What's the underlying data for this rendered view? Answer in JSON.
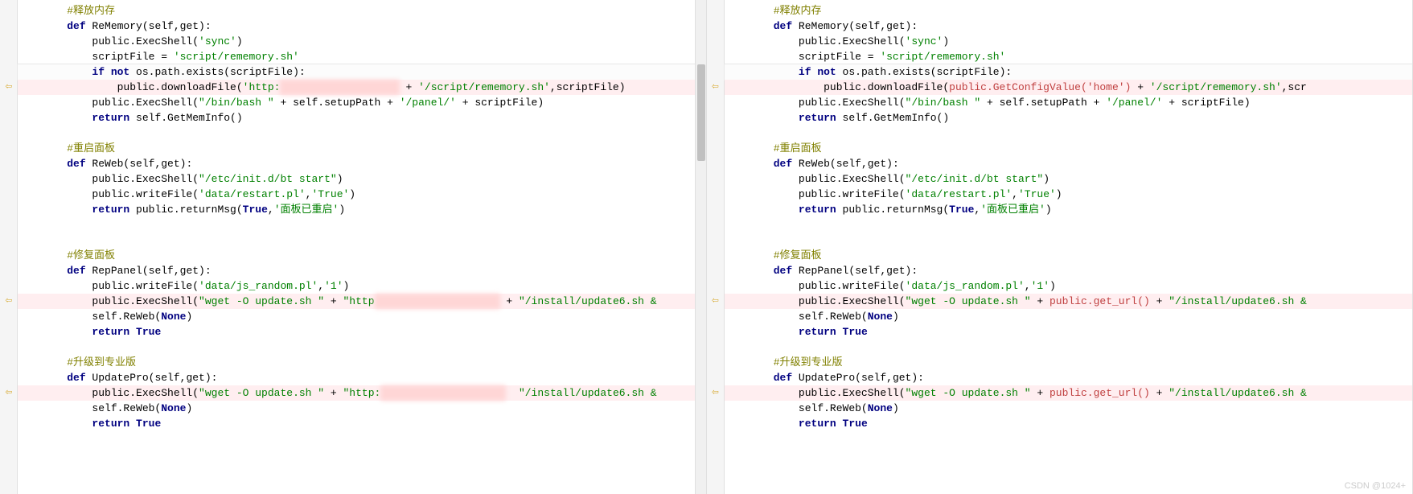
{
  "left": {
    "lines": [
      {
        "indent": 1,
        "type": "comment",
        "text": "#释放内存"
      },
      {
        "indent": 1,
        "type": "def",
        "kw": "def",
        "name": "ReMemory",
        "params": "(self,get):"
      },
      {
        "indent": 2,
        "type": "call",
        "prefix": "public.ExecShell(",
        "str": "'sync'",
        "suffix": ")"
      },
      {
        "indent": 2,
        "type": "assign",
        "prefix": "scriptFile = ",
        "str": "'script/rememory.sh'"
      },
      {
        "indent": 2,
        "type": "if",
        "kw": "if not",
        "rest": " os.path.exists(scriptFile):",
        "current": true
      },
      {
        "indent": 3,
        "type": "diff-call",
        "prefix": "public.downloadFile(",
        "str1": "'http:",
        "redacted": "xxxxxxxxxxxxxxxxxxx",
        "mid": " + ",
        "str2": "'/script/rememory.sh'",
        "suffix": ",scriptFile)",
        "diff": true,
        "arrow": true
      },
      {
        "indent": 2,
        "type": "call2",
        "prefix": "public.ExecShell(",
        "str1": "\"/bin/bash \"",
        "mid1": " + self.setupPath + ",
        "str2": "'/panel/'",
        "suffix": " + scriptFile)"
      },
      {
        "indent": 2,
        "type": "return",
        "kw": "return",
        "rest": " self.GetMemInfo()"
      },
      {
        "indent": 0,
        "type": "blank"
      },
      {
        "indent": 1,
        "type": "comment",
        "text": "#重启面板"
      },
      {
        "indent": 1,
        "type": "def",
        "kw": "def",
        "name": "ReWeb",
        "params": "(self,get):"
      },
      {
        "indent": 2,
        "type": "call",
        "prefix": "public.ExecShell(",
        "str": "\"/etc/init.d/bt start\"",
        "suffix": ")"
      },
      {
        "indent": 2,
        "type": "call3",
        "prefix": "public.writeFile(",
        "str1": "'data/restart.pl'",
        "mid": ",",
        "str2": "'True'",
        "suffix": ")"
      },
      {
        "indent": 2,
        "type": "return2",
        "kw": "return",
        "prefix": " public.returnMsg(",
        "bool": "True",
        "mid": ",",
        "str": "'面板已重启'",
        "suffix": ")"
      },
      {
        "indent": 0,
        "type": "blank"
      },
      {
        "indent": 0,
        "type": "blank"
      },
      {
        "indent": 1,
        "type": "comment",
        "text": "#修复面板"
      },
      {
        "indent": 1,
        "type": "def",
        "kw": "def",
        "name": "RepPanel",
        "params": "(self,get):"
      },
      {
        "indent": 2,
        "type": "call3",
        "prefix": "public.writeFile(",
        "str1": "'data/js_random.pl'",
        "mid": ",",
        "str2": "'1'",
        "suffix": ")"
      },
      {
        "indent": 2,
        "type": "diff-call2",
        "prefix": "public.ExecShell(",
        "str1": "\"wget -O update.sh \"",
        "mid1": " + ",
        "str2": "\"http",
        "redacted": "xxxxxxxxxxxxxxxxxxxx",
        "mid2": " + ",
        "str3": "\"/install/update6.sh &",
        "diff": true,
        "arrow": true
      },
      {
        "indent": 2,
        "type": "call4",
        "prefix": "self.ReWeb(",
        "bool": "None",
        "suffix": ")"
      },
      {
        "indent": 2,
        "type": "return3",
        "kw": "return",
        "bool": "True"
      },
      {
        "indent": 0,
        "type": "blank"
      },
      {
        "indent": 1,
        "type": "comment",
        "text": "#升级到专业版"
      },
      {
        "indent": 1,
        "type": "def",
        "kw": "def",
        "name": "UpdatePro",
        "params": "(self,get):"
      },
      {
        "indent": 2,
        "type": "diff-call2",
        "prefix": "public.ExecShell(",
        "str1": "\"wget -O update.sh \"",
        "mid1": " + ",
        "str2": "\"http:",
        "redacted": "xxxxxxxxxxxxxxxxxxxx",
        "mid2": "  ",
        "str3": "\"/install/update6.sh &",
        "diff": true,
        "arrow": true
      },
      {
        "indent": 2,
        "type": "call4",
        "prefix": "self.ReWeb(",
        "bool": "None",
        "suffix": ")"
      },
      {
        "indent": 2,
        "type": "return3",
        "kw": "return",
        "bool": "True"
      }
    ]
  },
  "right": {
    "lines": [
      {
        "indent": 1,
        "type": "comment",
        "text": "#释放内存"
      },
      {
        "indent": 1,
        "type": "def",
        "kw": "def",
        "name": "ReMemory",
        "params": "(self,get):"
      },
      {
        "indent": 2,
        "type": "call",
        "prefix": "public.ExecShell(",
        "str": "'sync'",
        "suffix": ")"
      },
      {
        "indent": 2,
        "type": "assign",
        "prefix": "scriptFile = ",
        "str": "'script/rememory.sh'"
      },
      {
        "indent": 2,
        "type": "if",
        "kw": "if not",
        "rest": " os.path.exists(scriptFile):",
        "current": true
      },
      {
        "indent": 3,
        "type": "diff-r1",
        "prefix": "public.downloadFile(",
        "red": "public.GetConfigValue('home')",
        "mid": " + ",
        "str": "'/script/rememory.sh'",
        "suffix": ",scr",
        "diff": true,
        "arrow": true
      },
      {
        "indent": 2,
        "type": "call2",
        "prefix": "public.ExecShell(",
        "str1": "\"/bin/bash \"",
        "mid1": " + self.setupPath + ",
        "str2": "'/panel/'",
        "suffix": " + scriptFile)"
      },
      {
        "indent": 2,
        "type": "return",
        "kw": "return",
        "rest": " self.GetMemInfo()"
      },
      {
        "indent": 0,
        "type": "blank"
      },
      {
        "indent": 1,
        "type": "comment",
        "text": "#重启面板"
      },
      {
        "indent": 1,
        "type": "def",
        "kw": "def",
        "name": "ReWeb",
        "params": "(self,get):"
      },
      {
        "indent": 2,
        "type": "call",
        "prefix": "public.ExecShell(",
        "str": "\"/etc/init.d/bt start\"",
        "suffix": ")"
      },
      {
        "indent": 2,
        "type": "call3",
        "prefix": "public.writeFile(",
        "str1": "'data/restart.pl'",
        "mid": ",",
        "str2": "'True'",
        "suffix": ")"
      },
      {
        "indent": 2,
        "type": "return2",
        "kw": "return",
        "prefix": " public.returnMsg(",
        "bool": "True",
        "mid": ",",
        "str": "'面板已重启'",
        "suffix": ")"
      },
      {
        "indent": 0,
        "type": "blank"
      },
      {
        "indent": 0,
        "type": "blank"
      },
      {
        "indent": 1,
        "type": "comment",
        "text": "#修复面板"
      },
      {
        "indent": 1,
        "type": "def",
        "kw": "def",
        "name": "RepPanel",
        "params": "(self,get):"
      },
      {
        "indent": 2,
        "type": "call3",
        "prefix": "public.writeFile(",
        "str1": "'data/js_random.pl'",
        "mid": ",",
        "str2": "'1'",
        "suffix": ")"
      },
      {
        "indent": 2,
        "type": "diff-r2",
        "prefix": "public.ExecShell(",
        "str1": "\"wget -O update.sh \"",
        "mid1": " + ",
        "red": "public.get_url()",
        "mid2": " + ",
        "str2": "\"/install/update6.sh &",
        "diff": true,
        "arrow": true
      },
      {
        "indent": 2,
        "type": "call4",
        "prefix": "self.ReWeb(",
        "bool": "None",
        "suffix": ")"
      },
      {
        "indent": 2,
        "type": "return3",
        "kw": "return",
        "bool": "True"
      },
      {
        "indent": 0,
        "type": "blank"
      },
      {
        "indent": 1,
        "type": "comment",
        "text": "#升级到专业版"
      },
      {
        "indent": 1,
        "type": "def",
        "kw": "def",
        "name": "UpdatePro",
        "params": "(self,get):"
      },
      {
        "indent": 2,
        "type": "diff-r2",
        "prefix": "public.ExecShell(",
        "str1": "\"wget -O update.sh \"",
        "mid1": " + ",
        "red": "public.get_url()",
        "mid2": " + ",
        "str2": "\"/install/update6.sh &",
        "diff": true,
        "arrow": true
      },
      {
        "indent": 2,
        "type": "call4",
        "prefix": "self.ReWeb(",
        "bool": "None",
        "suffix": ")"
      },
      {
        "indent": 2,
        "type": "return3",
        "kw": "return",
        "bool": "True"
      }
    ]
  },
  "watermark": "CSDN @1024+",
  "arrow_glyph": "⇦"
}
